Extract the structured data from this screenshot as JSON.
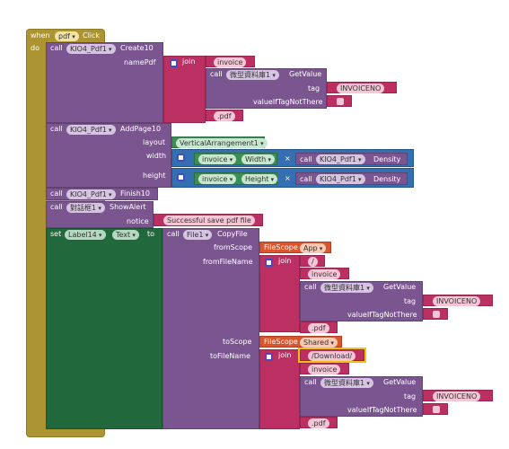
{
  "event": {
    "when": "when",
    "component": "pdf",
    "event": "Click",
    "do": "do"
  },
  "create": {
    "call": "call",
    "component": "KIO4_Pdf1",
    "method": "Create10",
    "param": "namePdf",
    "join": "join",
    "invoice": "invoice",
    "call2": "call",
    "db": "微型資料庫1",
    "getvalue": "GetValue",
    "tag_label": "tag",
    "tag": "INVOICENO",
    "vitnt": "valueIfTagNotThere",
    "ext": ".pdf"
  },
  "addpage": {
    "call": "call",
    "component": "KIO4_Pdf1",
    "method": "AddPage10",
    "layout_label": "layout",
    "layout": "VerticalArrangement1",
    "width_label": "width",
    "height_label": "height",
    "invoice": "invoice",
    "width": "Width",
    "height": "Height",
    "times": "×",
    "density": "Density"
  },
  "finish": {
    "call": "call",
    "component": "KIO4_Pdf1",
    "method": "Finish10"
  },
  "alert": {
    "call": "call",
    "component": "對話框1",
    "method": "ShowAlert",
    "notice_label": "notice",
    "notice": "Successful save pdf file"
  },
  "set": {
    "set": "set",
    "component": "Label14",
    "property": "Text",
    "to": "to"
  },
  "copy": {
    "call": "call",
    "component": "File1",
    "method": "CopyFile",
    "fromScope_label": "fromScope",
    "fromScope_kw": "FileScope",
    "fromScope": "App",
    "fromFileName_label": "fromFileName",
    "join": "join",
    "slash": "/",
    "invoice": "invoice",
    "db": "微型資料庫1",
    "getvalue": "GetValue",
    "tag_label": "tag",
    "tag": "INVOICENO",
    "vitnt": "valueIfTagNotThere",
    "ext": ".pdf",
    "toScope_label": "toScope",
    "toScope_kw": "FileScope",
    "toScope": "Shared",
    "toFileName_label": "toFileName",
    "download": "/Download/"
  },
  "colors": {
    "event": "#ad9432",
    "procedure": "#7a5590",
    "text": "#bc2f63",
    "math": "#346fb2",
    "component": "#3b8f53",
    "setter": "#22683d",
    "helper": "#d8552d"
  },
  "icons": [
    "gear-icon",
    "dropdown-arrow-icon",
    "quote-icon"
  ]
}
